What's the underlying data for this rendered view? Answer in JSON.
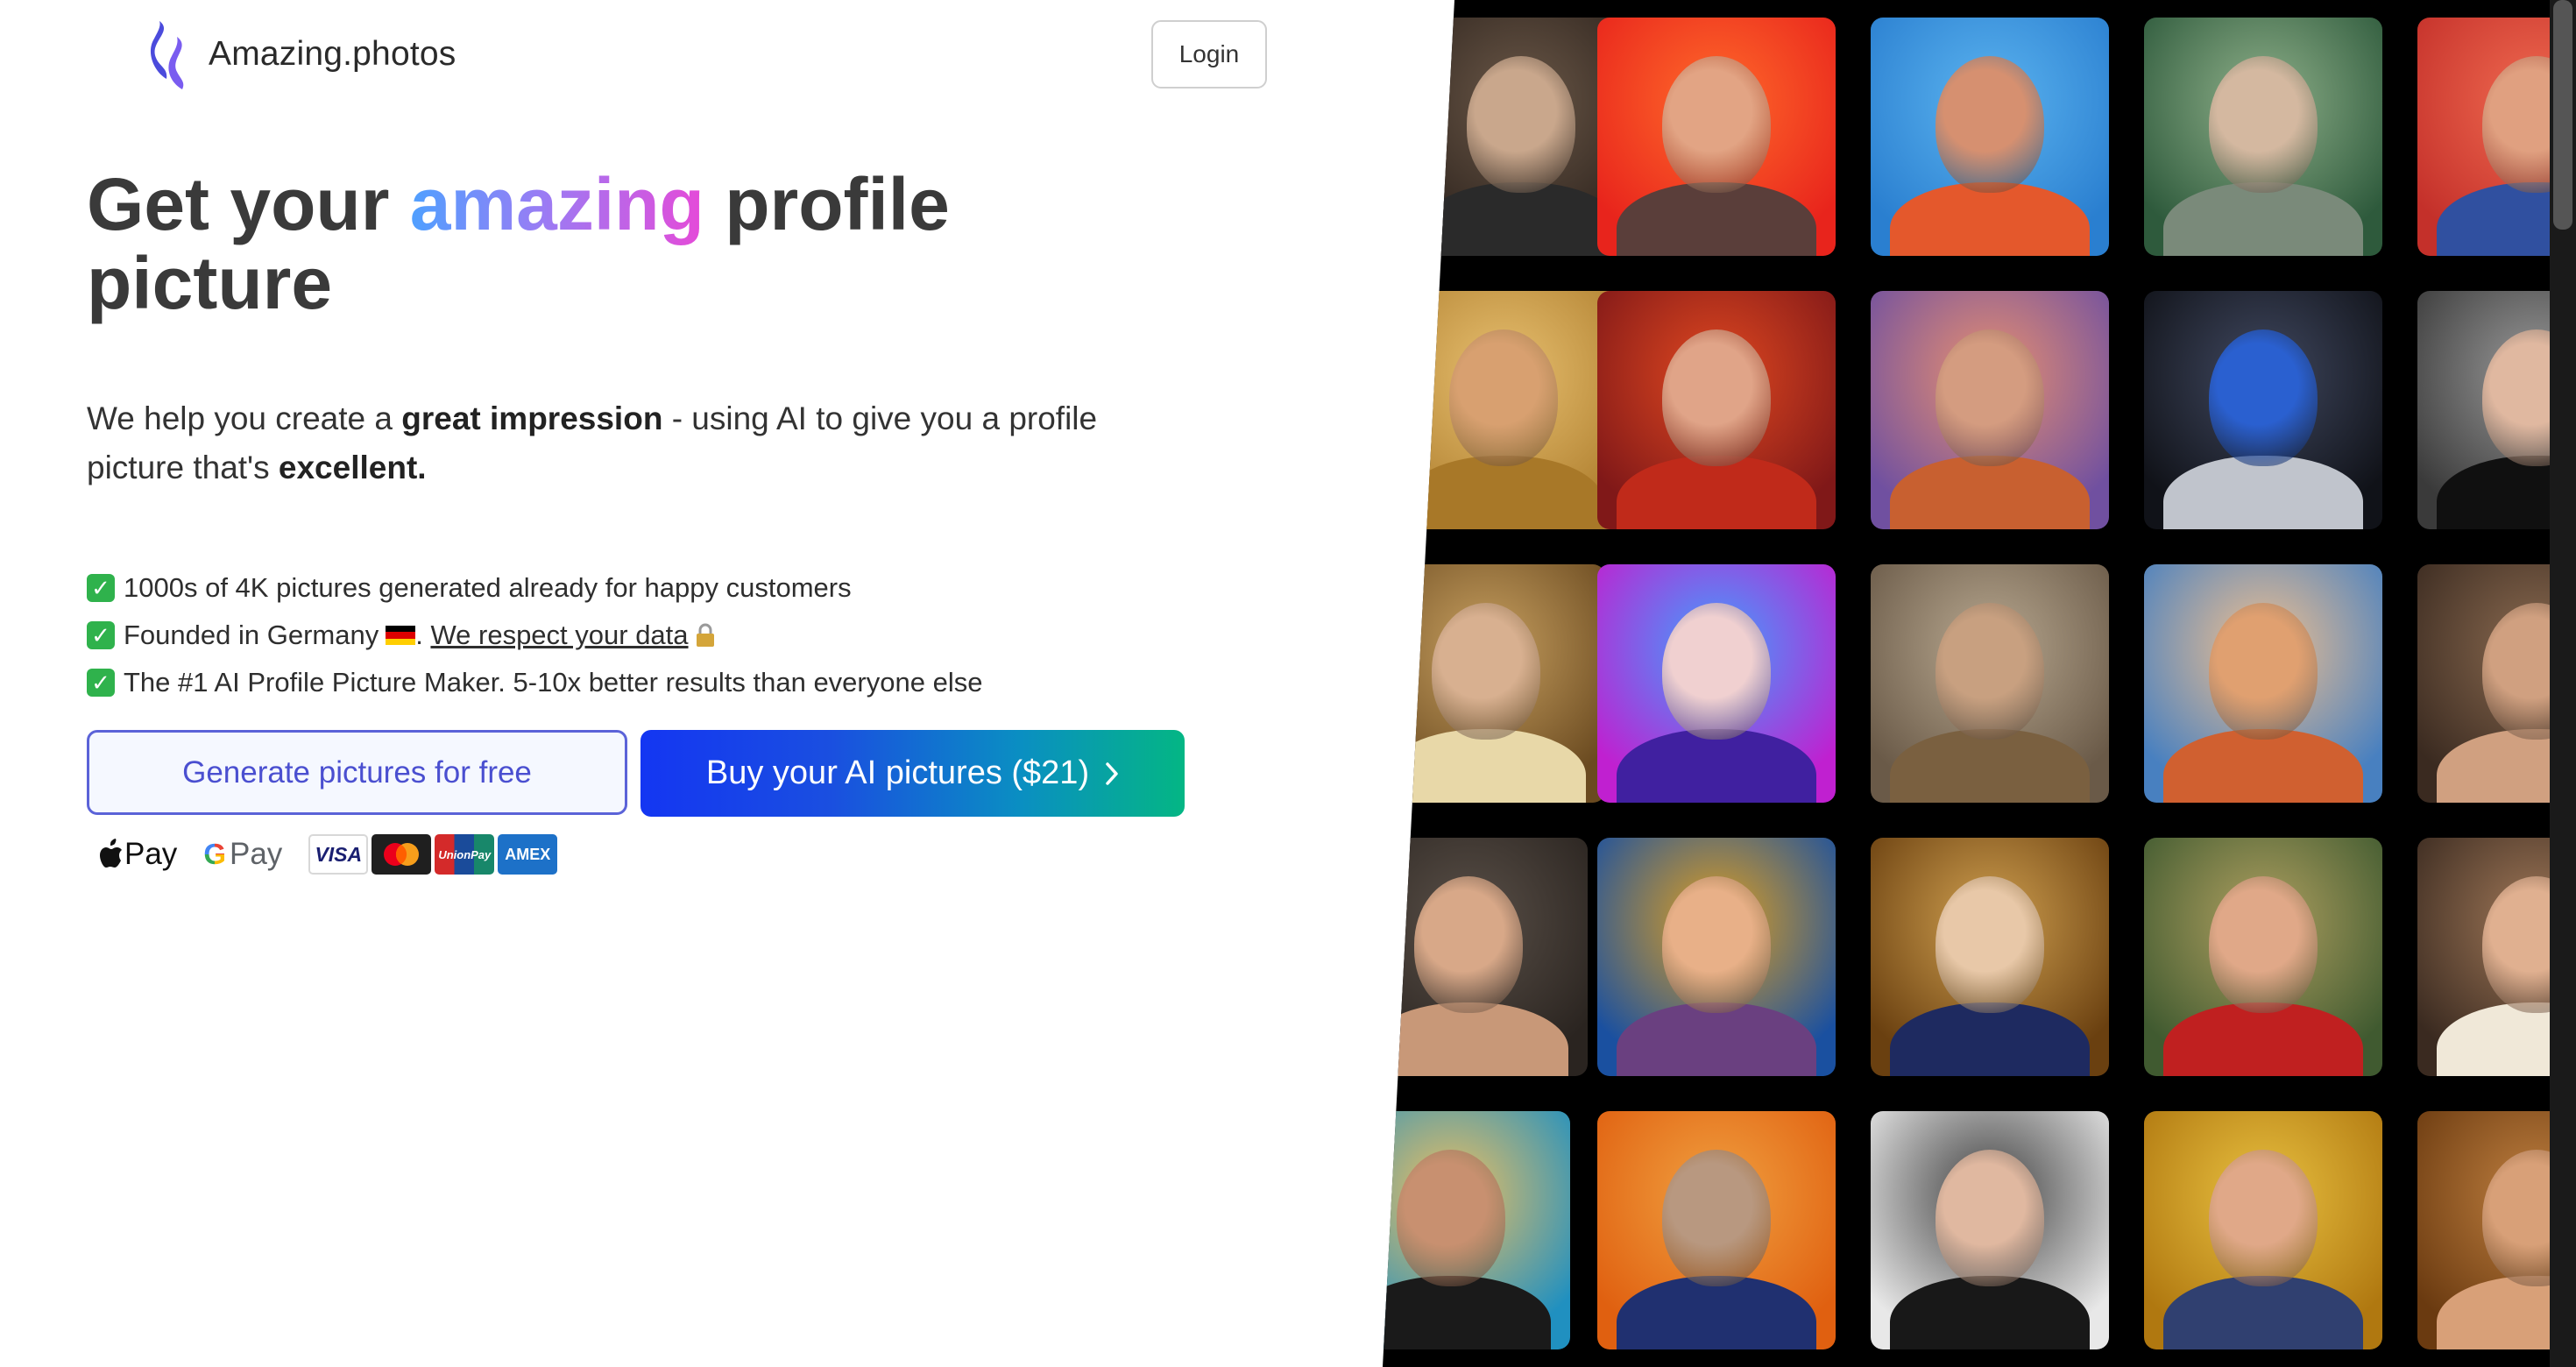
{
  "brand": {
    "name": "Amazing.photos",
    "logo_icon": "flame-logo-icon",
    "colors": [
      "#4b4bdc",
      "#7a5cf0"
    ]
  },
  "header": {
    "login_label": "Login"
  },
  "hero": {
    "title_before": "Get your",
    "title_highlight": "amazing",
    "title_after": "profile picture",
    "subtitle_part1": "We help you create a",
    "subtitle_bold1": "great impression",
    "subtitle_part2": "- using AI to give you a profile picture that's",
    "subtitle_bold2": "excellent."
  },
  "features": [
    {
      "icon": "check-icon",
      "text": "1000s of 4K pictures generated already for happy customers"
    },
    {
      "icon": "check-icon",
      "text_before": "Founded in Germany",
      "flag": "germany-flag-icon",
      "link": "We respect your data",
      "link_icon": "lock-icon"
    },
    {
      "icon": "check-icon",
      "text": "The #1 AI Profile Picture Maker. 5-10x better results than everyone else"
    }
  ],
  "cta": {
    "free_label": "Generate pictures for free",
    "buy_label": "Buy your AI pictures ($21)",
    "buy_gradient": [
      "#1436f2",
      "#04b684"
    ]
  },
  "payments": {
    "apple_pay": "Pay",
    "google_pay": "Pay",
    "visa": "VISA",
    "unionpay": "UnionPay",
    "amex": "AMEX"
  },
  "gallery": {
    "background": "#000000",
    "tiles": [
      {
        "c1": "#2c221c",
        "c2": "#6b5848",
        "skin": "#c9a78c",
        "cloth": "#2a2a2a"
      },
      {
        "c1": "#e8241c",
        "c2": "#ff6a2a",
        "skin": "#e2a484",
        "cloth": "#5a3e3a"
      },
      {
        "c1": "#2a7fd0",
        "c2": "#5bb3ef",
        "skin": "#d69070",
        "cloth": "#e4582c"
      },
      {
        "c1": "#2e5a3c",
        "c2": "#8fb08a",
        "skin": "#d4b8a0",
        "cloth": "#7a8a7a"
      },
      {
        "c1": "#c4302a",
        "c2": "#f06a50",
        "skin": "#e0a080",
        "cloth": "#3050a0"
      },
      {
        "c1": "#b08030",
        "c2": "#e8c070",
        "skin": "#d8a070",
        "cloth": "#a87828"
      },
      {
        "c1": "#801818",
        "c2": "#e04820",
        "skin": "#e0a488",
        "cloth": "#c02a1a"
      },
      {
        "c1": "#7050a0",
        "c2": "#e89070",
        "skin": "#d49c80",
        "cloth": "#c86030"
      },
      {
        "c1": "#101218",
        "c2": "#404860",
        "skin": "#2a60d0",
        "cloth": "#c0c4cc"
      },
      {
        "c1": "#3a3a3a",
        "c2": "#9a9a9a",
        "skin": "#e0b8a0",
        "cloth": "#101010"
      },
      {
        "c1": "#6a4a20",
        "c2": "#c8a060",
        "skin": "#d8b090",
        "cloth": "#e8d8a8"
      },
      {
        "c1": "#c020d0",
        "c2": "#40a0ff",
        "skin": "#f0d0d0",
        "cloth": "#4020a0"
      },
      {
        "c1": "#6a5a48",
        "c2": "#b8a890",
        "skin": "#c8a080",
        "cloth": "#7a6040"
      },
      {
        "c1": "#4880c0",
        "c2": "#f0c090",
        "skin": "#e0a070",
        "cloth": "#d06030"
      },
      {
        "c1": "#3a2a20",
        "c2": "#8a6a50",
        "skin": "#d0a080",
        "cloth": "#d0a080"
      },
      {
        "c1": "#2a2420",
        "c2": "#5a5048",
        "skin": "#d8a888",
        "cloth": "#c89878"
      },
      {
        "c1": "#1a50a0",
        "c2": "#e0a020",
        "skin": "#e8b088",
        "cloth": "#6a4080"
      },
      {
        "c1": "#6a4010",
        "c2": "#d0a050",
        "skin": "#e8c8a8",
        "cloth": "#1e2a60"
      },
      {
        "c1": "#405a30",
        "c2": "#b0a060",
        "skin": "#e0a888",
        "cloth": "#c02020"
      },
      {
        "c1": "#3a2a20",
        "c2": "#a07858",
        "skin": "#e0b090",
        "cloth": "#f0e8d8"
      },
      {
        "c1": "#2090c0",
        "c2": "#f0c060",
        "skin": "#c89070",
        "cloth": "#1a1a1a"
      },
      {
        "c1": "#e06010",
        "c2": "#f0a040",
        "skin": "#b89880",
        "cloth": "#203070"
      },
      {
        "c1": "#e8e8e8",
        "c2": "#404040",
        "skin": "#e0b8a0",
        "cloth": "#181818"
      },
      {
        "c1": "#b07810",
        "c2": "#e8c040",
        "skin": "#e0a888",
        "cloth": "#304070"
      },
      {
        "c1": "#6a3a10",
        "c2": "#c08040",
        "skin": "#d8a078",
        "cloth": "#d8a078"
      }
    ]
  }
}
